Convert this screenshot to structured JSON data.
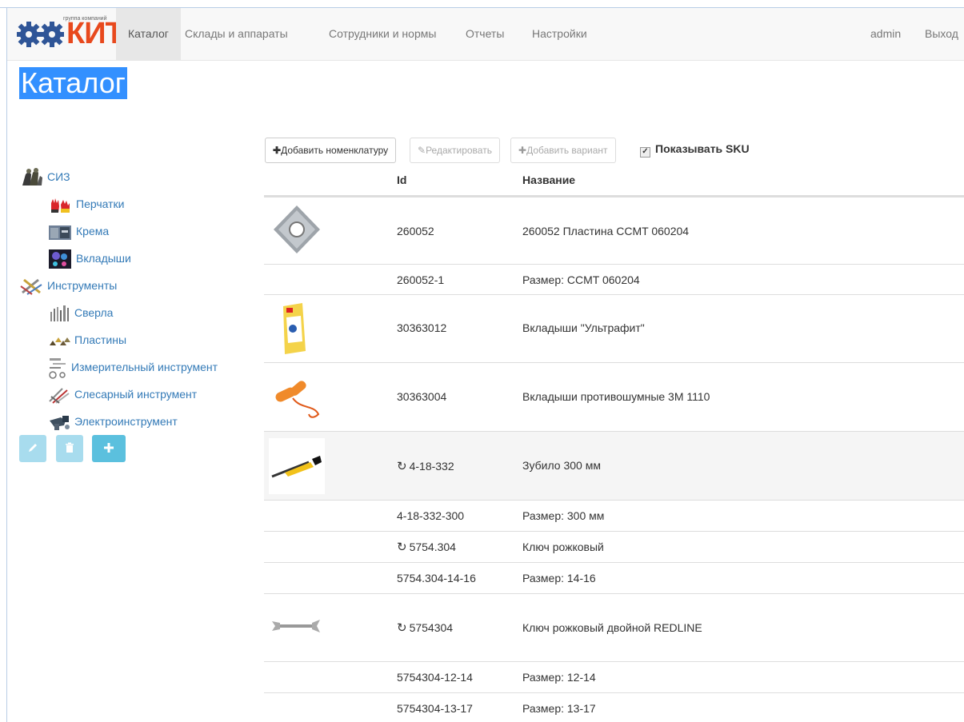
{
  "brand": {
    "small_text": "группа компаний",
    "name": "КИТ"
  },
  "nav": {
    "items": [
      {
        "label": "Каталог",
        "active": true
      },
      {
        "label": "Склады и аппараты"
      },
      {
        "label": "Сотрудники и нормы"
      },
      {
        "label": "Отчеты"
      },
      {
        "label": "Настройки"
      }
    ],
    "user": "admin",
    "logout": "Выход"
  },
  "page_title": "Каталог",
  "tree": [
    {
      "label": "СИЗ",
      "icon": "ppe-icon",
      "level": 0
    },
    {
      "label": "Перчатки",
      "icon": "gloves-icon",
      "level": 1
    },
    {
      "label": "Крема",
      "icon": "cream-icon",
      "level": 1
    },
    {
      "label": "Вкладыши",
      "icon": "earplugs-icon",
      "level": 1
    },
    {
      "label": "Инструменты",
      "icon": "tools-icon",
      "level": 0
    },
    {
      "label": "Сверла",
      "icon": "drills-icon",
      "level": 1
    },
    {
      "label": "Пластины",
      "icon": "inserts-icon",
      "level": 1
    },
    {
      "label": "Измерительный инструмент",
      "icon": "measuring-icon",
      "level": 1
    },
    {
      "label": "Слесарный инструмент",
      "icon": "locksmith-icon",
      "level": 1
    },
    {
      "label": "Электроинструмент",
      "icon": "power-tool-icon",
      "level": 1
    }
  ],
  "toolbar": {
    "add_nomenclature": "Добавить номенклатуру",
    "edit": "Редактировать",
    "add_variant": "Добавить вариант",
    "show_sku": "Показывать SKU"
  },
  "table": {
    "headers": {
      "id": "Id",
      "name": "Название"
    },
    "rows": [
      {
        "id": "260052",
        "name": "260052 Пластина CCMT 060204",
        "thumb": "insert-image",
        "variant": true
      },
      {
        "id": "260052-1",
        "name": "Размер: CCMT 060204"
      },
      {
        "id": "30363012",
        "name": "Вкладыши \"Ультрафит\"",
        "thumb": "earplug-pack-image"
      },
      {
        "id": "30363004",
        "name": "Вкладыши противошумные 3M 1110",
        "thumb": "earplugs-image"
      },
      {
        "id": "4-18-332",
        "name": "Зубило 300 мм",
        "thumb": "chisel-image",
        "refresh": true
      },
      {
        "id": "4-18-332-300",
        "name": "Размер: 300 мм"
      },
      {
        "id": "5754.304",
        "name": "Ключ рожковый",
        "refresh": true
      },
      {
        "id": "5754.304-14-16",
        "name": "Размер: 14-16"
      },
      {
        "id": "5754304",
        "name": "Ключ рожковый двойной REDLINE",
        "thumb": "wrench-image",
        "refresh": true
      },
      {
        "id": "5754304-12-14",
        "name": "Размер: 12-14"
      },
      {
        "id": "5754304-13-17",
        "name": "Размер: 13-17"
      }
    ]
  },
  "colors": {
    "link": "#337ab7",
    "tree_button": "#5bc0de",
    "selection": "#3390ff",
    "logo": "#e8491d"
  }
}
